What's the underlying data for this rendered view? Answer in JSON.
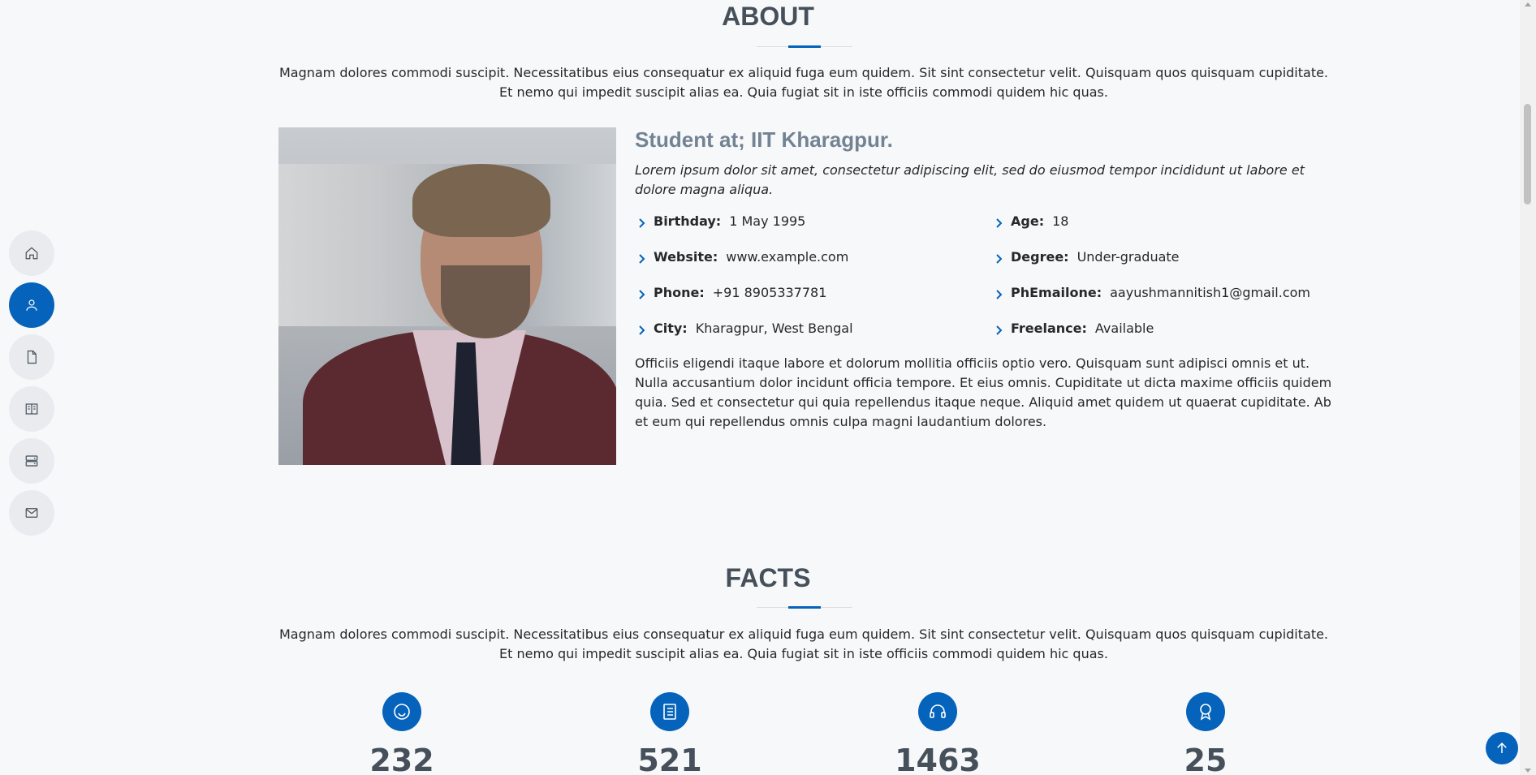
{
  "about": {
    "title": "ABOUT",
    "intro": "Magnam dolores commodi suscipit. Necessitatibus eius consequatur ex aliquid fuga eum quidem. Sit sint consectetur velit. Quisquam quos quisquam cupiditate. Et nemo qui impedit suscipit alias ea. Quia fugiat sit in iste officiis commodi quidem hic quas.",
    "role": "Student at; IIT Kharagpur.",
    "italic": "Lorem ipsum dolor sit amet, consectetur adipiscing elit, sed do eiusmod tempor incididunt ut labore et dolore magna aliqua.",
    "facts": [
      {
        "label": "Birthday:",
        "value": "1 May 1995"
      },
      {
        "label": "Age:",
        "value": "18"
      },
      {
        "label": "Website:",
        "value": "www.example.com"
      },
      {
        "label": "Degree:",
        "value": "Under-graduate"
      },
      {
        "label": "Phone:",
        "value": "+91 8905337781"
      },
      {
        "label": "PhEmailone:",
        "value": "aayushmannitish1@gmail.com"
      },
      {
        "label": "City:",
        "value": "Kharagpur, West Bengal"
      },
      {
        "label": "Freelance:",
        "value": "Available"
      }
    ],
    "paragraph": "Officiis eligendi itaque labore et dolorum mollitia officiis optio vero. Quisquam sunt adipisci omnis et ut. Nulla accusantium dolor incidunt officia tempore. Et eius omnis. Cupiditate ut dicta maxime officiis quidem quia. Sed et consectetur qui quia repellendus itaque neque. Aliquid amet quidem ut quaerat cupiditate. Ab et eum qui repellendus omnis culpa magni laudantium dolores."
  },
  "facts_section": {
    "title": "FACTS",
    "intro": "Magnam dolores commodi suscipit. Necessitatibus eius consequatur ex aliquid fuga eum quidem. Sit sint consectetur velit. Quisquam quos quisquam cupiditate. Et nemo qui impedit suscipit alias ea. Quia fugiat sit in iste officiis commodi quidem hic quas.",
    "counters": [
      {
        "icon": "smiley-icon",
        "value": "232"
      },
      {
        "icon": "journal-icon",
        "value": "521"
      },
      {
        "icon": "headset-icon",
        "value": "1463"
      },
      {
        "icon": "award-icon",
        "value": "25"
      }
    ]
  },
  "nav": {
    "items": [
      {
        "icon": "home-icon",
        "active": false
      },
      {
        "icon": "person-icon",
        "active": true
      },
      {
        "icon": "file-icon",
        "active": false
      },
      {
        "icon": "book-icon",
        "active": false
      },
      {
        "icon": "server-icon",
        "active": false
      },
      {
        "icon": "envelope-icon",
        "active": false
      }
    ]
  },
  "colors": {
    "accent": "#0563bb",
    "heading": "#45505b",
    "role": "#728394"
  }
}
